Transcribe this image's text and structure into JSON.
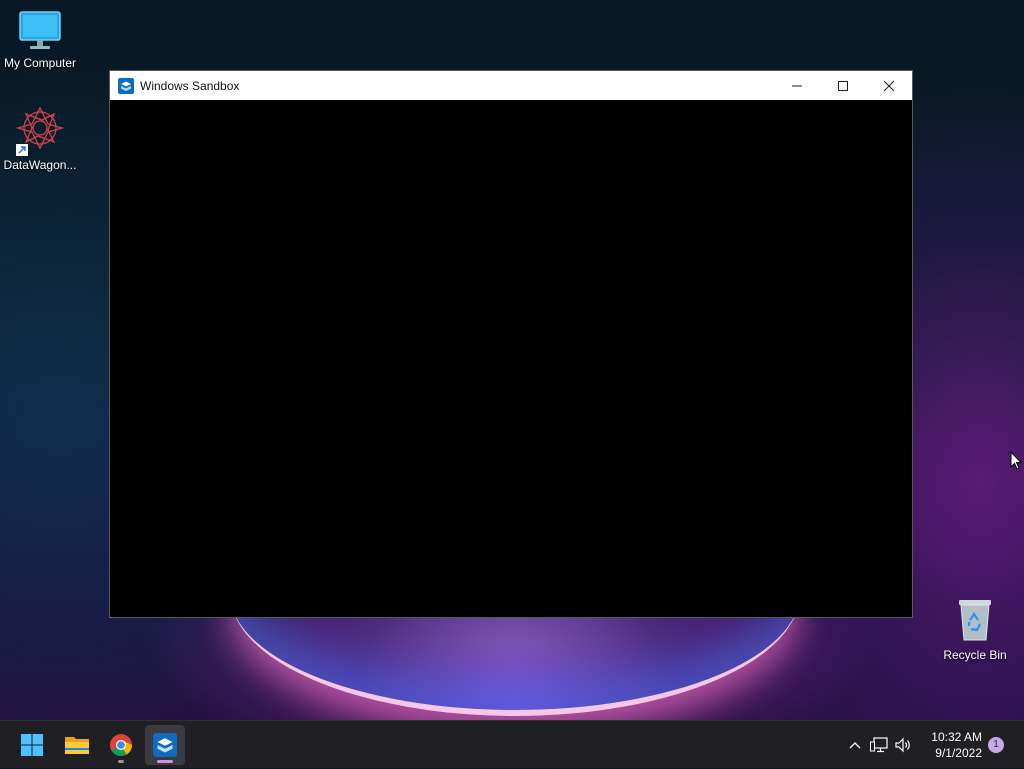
{
  "desktop": {
    "icons": [
      {
        "label": "My Computer",
        "icon": "monitor-icon"
      },
      {
        "label": "DataWagon...",
        "icon": "datawagon-app-icon"
      },
      {
        "label": "Recycle Bin",
        "icon": "recycle-bin-icon"
      }
    ]
  },
  "window": {
    "title": "Windows Sandbox",
    "icon": "sandbox-icon",
    "controls": [
      "minimize-icon",
      "maximize-icon",
      "close-icon"
    ]
  },
  "taskbar": {
    "apps": [
      {
        "name": "Start",
        "icon": "windows-start-icon"
      },
      {
        "name": "File Explorer",
        "icon": "folder-icon"
      },
      {
        "name": "Google Chrome",
        "icon": "chrome-icon"
      },
      {
        "name": "Windows Sandbox",
        "icon": "sandbox-icon",
        "active": true
      }
    ],
    "tray": {
      "icons": [
        "chevron-up-icon",
        "network-icon",
        "volume-icon"
      ],
      "time": "10:32 AM",
      "date": "9/1/2022",
      "notification_count": "1"
    }
  },
  "colors": {
    "accent": "#0f6cbd",
    "indicator_active": "#d58fe0",
    "notification_badge": "#c9a9e8"
  }
}
